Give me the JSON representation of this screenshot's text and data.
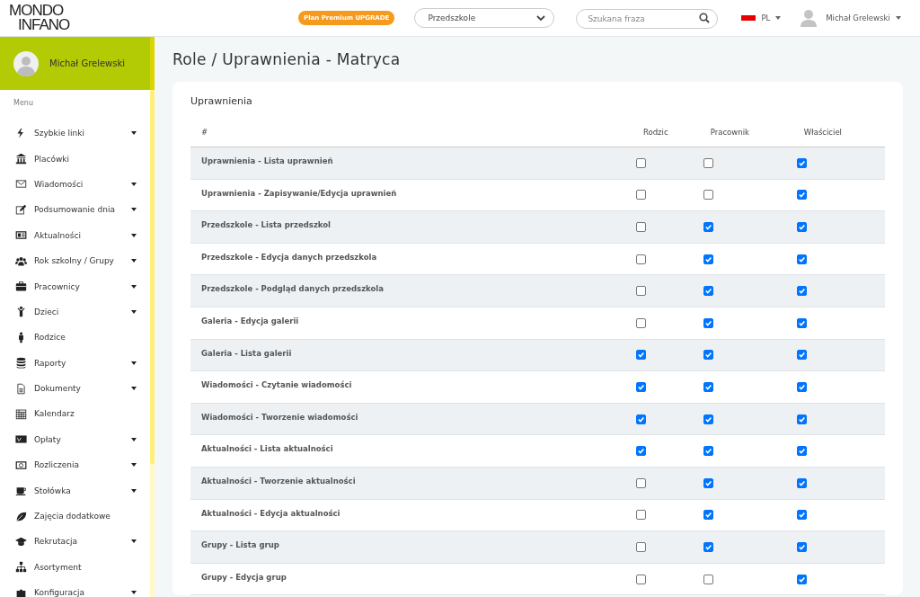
{
  "header": {
    "logo_lines": [
      "MONDO",
      "INFANO"
    ],
    "upgrade_badge": "Plan Premium UPGRADE",
    "facility_select": {
      "value": "Przedszkole"
    },
    "search": {
      "placeholder": "Szukana fraza"
    },
    "language": "PL",
    "user_menu": "Michał Grelewski"
  },
  "sidebar": {
    "user_name": "Michał Grelewski",
    "menu_heading": "Menu",
    "items": [
      {
        "label": "Szybkie linki",
        "has_submenu": true
      },
      {
        "label": "Placówki",
        "has_submenu": false
      },
      {
        "label": "Wiadomości",
        "has_submenu": true
      },
      {
        "label": "Podsumowanie dnia",
        "has_submenu": true
      },
      {
        "label": "Aktualności",
        "has_submenu": true
      },
      {
        "label": "Rok szkolny / Grupy",
        "has_submenu": true
      },
      {
        "label": "Pracownicy",
        "has_submenu": true
      },
      {
        "label": "Dzieci",
        "has_submenu": true
      },
      {
        "label": "Rodzice",
        "has_submenu": false
      },
      {
        "label": "Raporty",
        "has_submenu": true
      },
      {
        "label": "Dokumenty",
        "has_submenu": true
      },
      {
        "label": "Kalendarz",
        "has_submenu": false
      },
      {
        "label": "Opłaty",
        "has_submenu": true
      },
      {
        "label": "Rozliczenia",
        "has_submenu": true
      },
      {
        "label": "Stołówka",
        "has_submenu": true
      },
      {
        "label": "Zajęcia dodatkowe",
        "has_submenu": false
      },
      {
        "label": "Rekrutacja",
        "has_submenu": true
      },
      {
        "label": "Asortyment",
        "has_submenu": false
      },
      {
        "label": "Konfiguracja",
        "has_submenu": true
      }
    ]
  },
  "page_title": "Role / Uprawnienia - Matryca",
  "card": {
    "title": "Uprawnienia",
    "table": {
      "columns": [
        "#",
        "Rodzic",
        "Pracownik",
        "Właściciel"
      ],
      "rows": [
        {
          "name": "Uprawnienia - Lista uprawnień",
          "checks": [
            false,
            false,
            true
          ]
        },
        {
          "name": "Uprawnienia - Zapisywanie/Edycja uprawnień",
          "checks": [
            false,
            false,
            true
          ]
        },
        {
          "name": "Przedszkole - Lista przedszkol",
          "checks": [
            false,
            true,
            true
          ]
        },
        {
          "name": "Przedszkole - Edycja danych przedszkola",
          "checks": [
            false,
            true,
            true
          ]
        },
        {
          "name": "Przedszkole - Podgląd danych przedszkola",
          "checks": [
            false,
            true,
            true
          ]
        },
        {
          "name": "Galeria - Edycja galerii",
          "checks": [
            false,
            true,
            true
          ]
        },
        {
          "name": "Galeria - Lista galerii",
          "checks": [
            true,
            true,
            true
          ]
        },
        {
          "name": "Wiadomości - Czytanie wiadomości",
          "checks": [
            true,
            true,
            true
          ]
        },
        {
          "name": "Wiadomości - Tworzenie wiadomości",
          "checks": [
            true,
            true,
            true
          ]
        },
        {
          "name": "Aktualności - Lista aktualności",
          "checks": [
            true,
            true,
            true
          ]
        },
        {
          "name": "Aktualności - Tworzenie aktualności",
          "checks": [
            false,
            true,
            true
          ]
        },
        {
          "name": "Aktualności - Edycja aktualności",
          "checks": [
            false,
            true,
            true
          ]
        },
        {
          "name": "Grupy - Lista grup",
          "checks": [
            false,
            true,
            true
          ]
        },
        {
          "name": "Grupy - Edycja grup",
          "checks": [
            false,
            false,
            true
          ]
        }
      ]
    }
  }
}
